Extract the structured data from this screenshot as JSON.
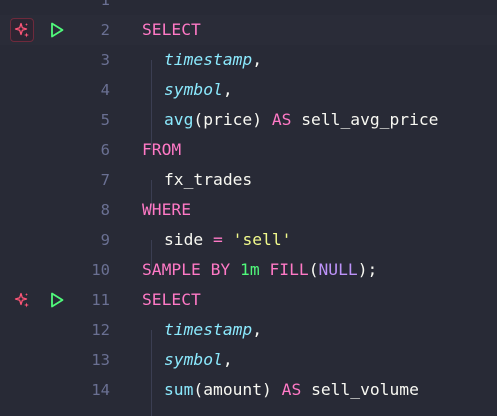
{
  "colors": {
    "background": "#282a36",
    "line_number": "#6a7093",
    "keyword": "#ff79c6",
    "column": "#8be9fd",
    "string": "#f1fa8c",
    "number": "#50fa7b",
    "null": "#bd93f9",
    "ai_icon": "#ff5577",
    "run_icon": "#50fa7b"
  },
  "gutter_icons": {
    "ai": "sparkle-icon",
    "run": "play-icon"
  },
  "lines": [
    {
      "num": "1",
      "tokens": []
    },
    {
      "num": "2",
      "tokens": [
        {
          "t": "SELECT",
          "c": "kw"
        }
      ]
    },
    {
      "num": "3",
      "tokens": [
        {
          "t": "timestamp",
          "c": "col"
        },
        {
          "t": ",",
          "c": "plain"
        }
      ]
    },
    {
      "num": "4",
      "tokens": [
        {
          "t": "symbol",
          "c": "col"
        },
        {
          "t": ",",
          "c": "plain"
        }
      ]
    },
    {
      "num": "5",
      "tokens": [
        {
          "t": "avg",
          "c": "fn"
        },
        {
          "t": "(price) ",
          "c": "plain"
        },
        {
          "t": "AS",
          "c": "kw"
        },
        {
          "t": " sell_avg_price",
          "c": "plain"
        }
      ]
    },
    {
      "num": "6",
      "tokens": [
        {
          "t": "FROM",
          "c": "kw"
        }
      ]
    },
    {
      "num": "7",
      "tokens": [
        {
          "t": "fx_trades",
          "c": "plain"
        }
      ]
    },
    {
      "num": "8",
      "tokens": [
        {
          "t": "WHERE",
          "c": "kw"
        }
      ]
    },
    {
      "num": "9",
      "tokens": [
        {
          "t": "side ",
          "c": "plain"
        },
        {
          "t": "=",
          "c": "op"
        },
        {
          "t": " ",
          "c": "plain"
        },
        {
          "t": "'sell'",
          "c": "str"
        }
      ]
    },
    {
      "num": "10",
      "tokens": [
        {
          "t": "SAMPLE BY",
          "c": "kw"
        },
        {
          "t": " ",
          "c": "plain"
        },
        {
          "t": "1m",
          "c": "num"
        },
        {
          "t": " ",
          "c": "plain"
        },
        {
          "t": "FILL",
          "c": "kw"
        },
        {
          "t": "(",
          "c": "plain"
        },
        {
          "t": "NULL",
          "c": "null"
        },
        {
          "t": ");",
          "c": "plain"
        }
      ]
    },
    {
      "num": "11",
      "tokens": [
        {
          "t": "SELECT",
          "c": "kw"
        }
      ]
    },
    {
      "num": "12",
      "tokens": [
        {
          "t": "timestamp",
          "c": "col"
        },
        {
          "t": ",",
          "c": "plain"
        }
      ]
    },
    {
      "num": "13",
      "tokens": [
        {
          "t": "symbol",
          "c": "col"
        },
        {
          "t": ",",
          "c": "plain"
        }
      ]
    },
    {
      "num": "14",
      "tokens": [
        {
          "t": "sum",
          "c": "fn"
        },
        {
          "t": "(amount) ",
          "c": "plain"
        },
        {
          "t": "AS",
          "c": "kw"
        },
        {
          "t": " sell_volume",
          "c": "plain"
        }
      ]
    }
  ]
}
